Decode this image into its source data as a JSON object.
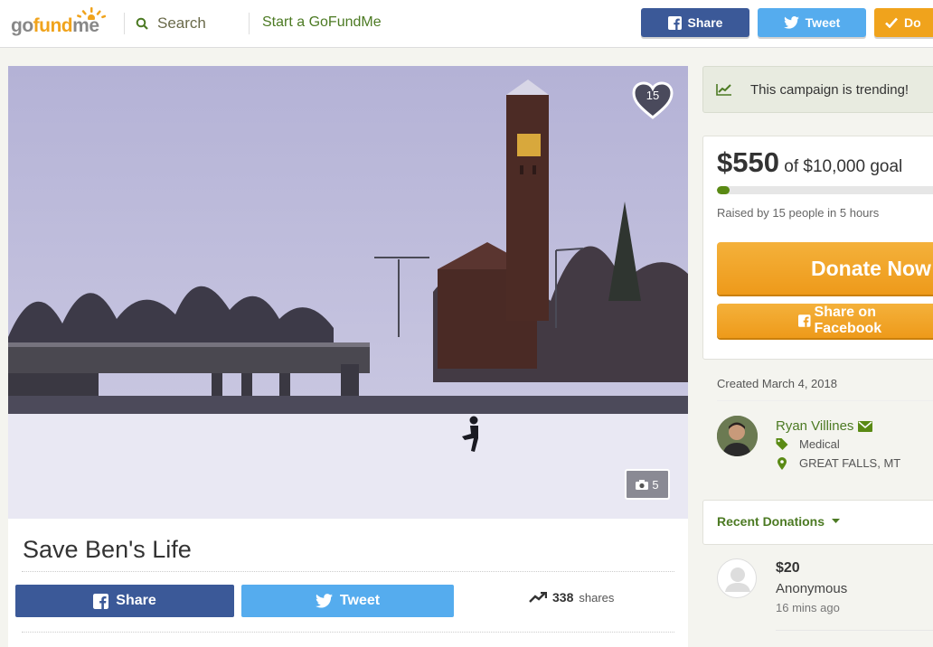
{
  "brand": {
    "logo_part1": "go",
    "logo_part2": "fund",
    "logo_part3": "me"
  },
  "header": {
    "search_label": "Search",
    "start_label": "Start a GoFundMe",
    "share_label": "Share",
    "tweet_label": "Tweet",
    "donate_label": "Do"
  },
  "colors": {
    "brand_green": "#4c7a23",
    "facebook": "#3b5998",
    "twitter": "#55acee",
    "donate": "#f0a31c"
  },
  "campaign": {
    "hearts": "15",
    "photo_count": "5",
    "title": "Save Ben's Life",
    "share_label": "Share",
    "tweet_label": "Tweet",
    "share_count": "338",
    "shares_word": "shares"
  },
  "sidebar": {
    "trending": "This campaign is trending!",
    "raised_amount": "$550",
    "goal_text": "of $10,000 goal",
    "progress_fraction": 0.055,
    "raised_by": "Raised by 15 people in 5 hours",
    "donate_label": "Donate Now",
    "share_facebook_label": "Share on Facebook",
    "created": "Created March 4, 2018",
    "organizer_name": "Ryan Villines",
    "category": "Medical",
    "location": "GREAT FALLS, MT",
    "recent_label": "Recent Donations"
  },
  "donations": [
    {
      "amount": "$20",
      "name": "Anonymous",
      "time": "16 mins ago"
    }
  ]
}
